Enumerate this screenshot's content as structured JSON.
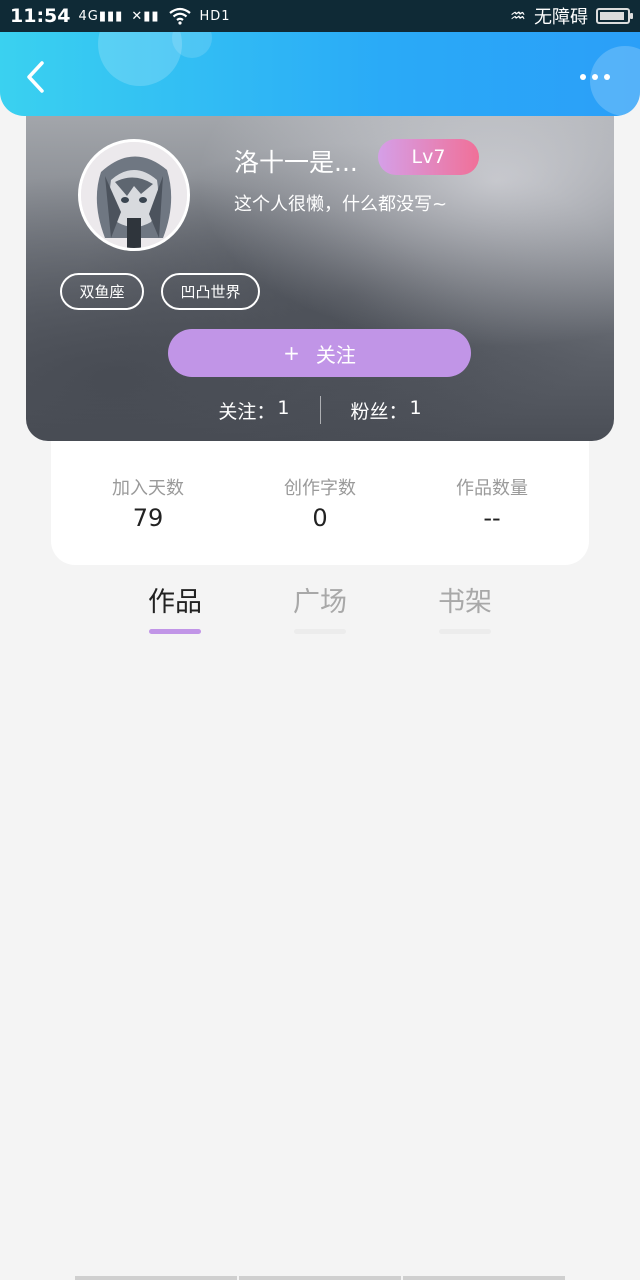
{
  "status_bar": {
    "time": "11:54",
    "network": "4G",
    "hd": "HD1",
    "accessibility_label": "无障碍"
  },
  "header": {
    "back_icon": "chevron-left-icon",
    "more_icon": "more-dots-icon"
  },
  "profile": {
    "username": "洛十一是...",
    "level": "Lv7",
    "bio": "这个人很懒，什么都没写~",
    "tags": [
      "双鱼座",
      "凹凸世界"
    ],
    "follow_button": {
      "plus": "+",
      "label": "关注"
    },
    "following": {
      "label": "关注：",
      "value": "1"
    },
    "followers": {
      "label": "粉丝：",
      "value": "1"
    }
  },
  "stats": [
    {
      "label": "加入天数",
      "value": "79"
    },
    {
      "label": "创作字数",
      "value": "0"
    },
    {
      "label": "作品数量",
      "value": "--"
    }
  ],
  "tabs": [
    {
      "label": "作品",
      "active": true
    },
    {
      "label": "广场",
      "active": false
    },
    {
      "label": "书架",
      "active": false
    }
  ],
  "colors": {
    "accent_purple": "#c195e7",
    "header_blue": "#2aaaf7",
    "level_gradient_start": "#d59fe8",
    "level_gradient_end": "#f07098"
  }
}
